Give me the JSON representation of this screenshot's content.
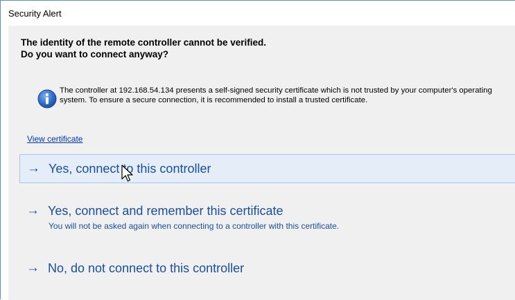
{
  "window": {
    "title": "Security Alert"
  },
  "dialog": {
    "heading_line1": "The identity of the remote controller cannot be verified.",
    "heading_line2": "Do you want to connect anyway?",
    "message": "The controller at 192.168.54.134 presents a self-signed security certificate which is not trusted by your computer's operating system. To ensure a secure connection, it is recommended to install a trusted certificate.",
    "info_icon": "info-icon",
    "view_certificate_link": "View certificate"
  },
  "commands": [
    {
      "arrow": "→",
      "label": "Yes, connect to this controller",
      "subtext": "",
      "hovered": true
    },
    {
      "arrow": "→",
      "label": "Yes, connect and remember this certificate",
      "subtext": "You will not be asked again when connecting to a controller with this certificate.",
      "hovered": false
    },
    {
      "arrow": "→",
      "label": "No, do not connect to this controller",
      "subtext": "",
      "hovered": false
    }
  ],
  "colors": {
    "accent": "#1a4fa0",
    "link": "#0033cc",
    "content_bg": "#f0f0f0",
    "hover_bg": "#e5eef8",
    "hover_border": "#a9c7ea",
    "window_border": "#5a8fd6"
  }
}
